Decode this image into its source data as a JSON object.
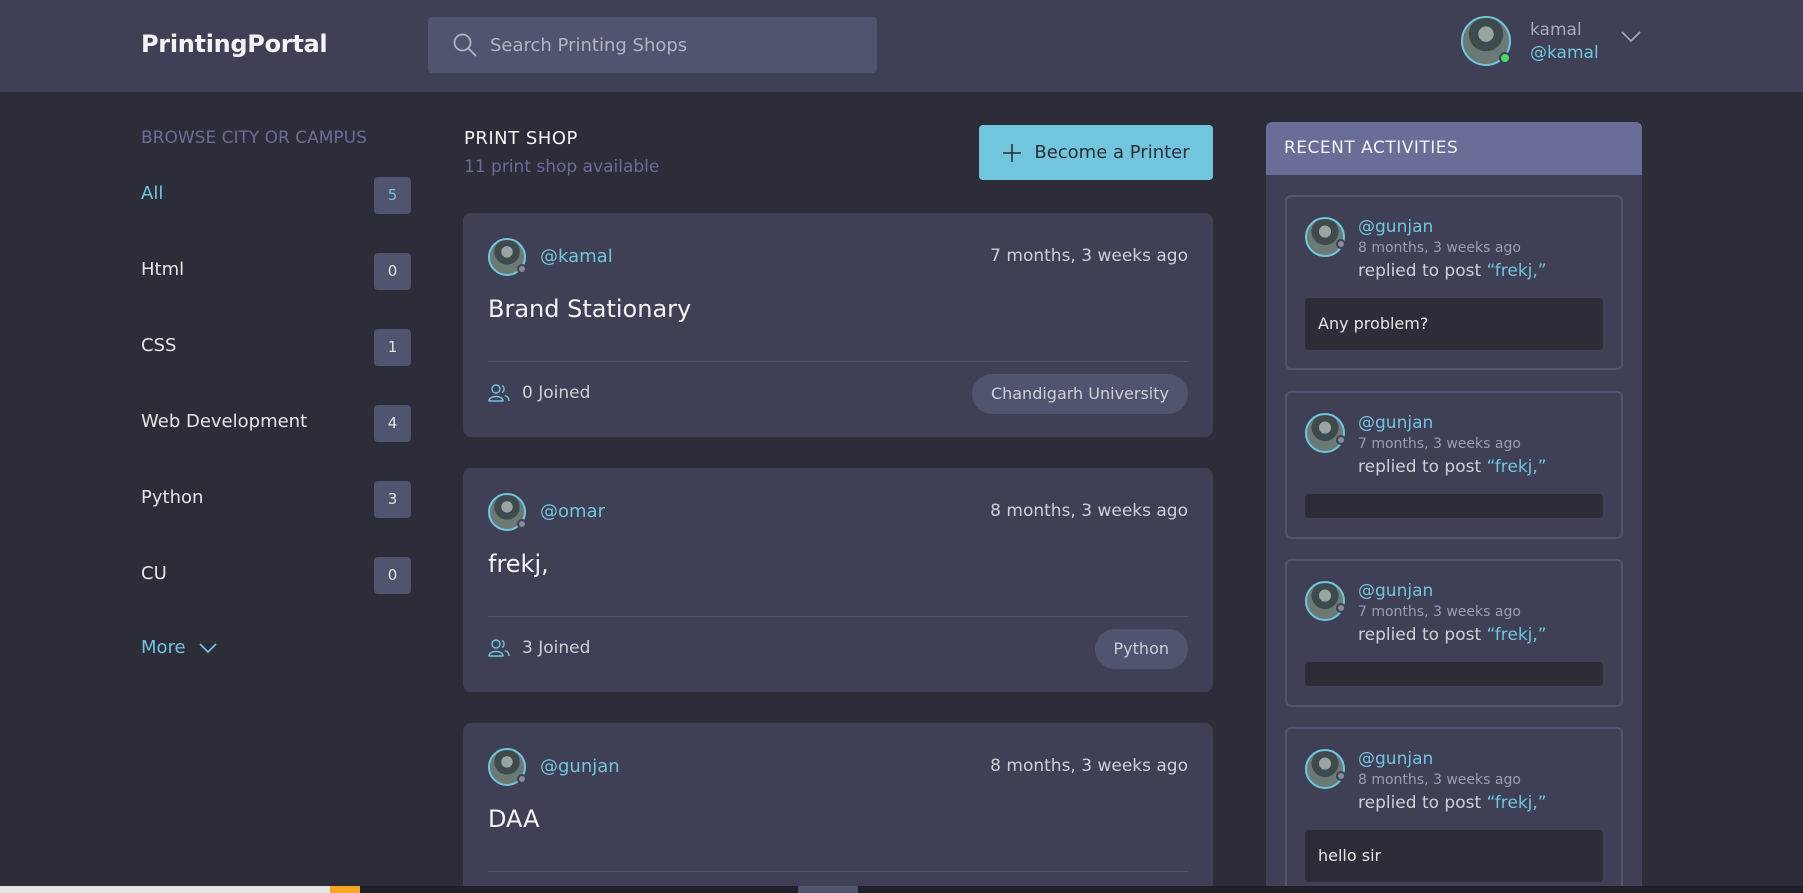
{
  "header": {
    "logo": "PrintingPortal",
    "search_placeholder": "Search Printing Shops",
    "user_name": "kamal",
    "user_handle": "@kamal"
  },
  "sidebar": {
    "title": "BROWSE CITY OR CAMPUS",
    "topics": [
      {
        "name": "All",
        "count": "5"
      },
      {
        "name": "Html",
        "count": "0"
      },
      {
        "name": "CSS",
        "count": "1"
      },
      {
        "name": "Web Development",
        "count": "4"
      },
      {
        "name": "Python",
        "count": "3"
      },
      {
        "name": "CU",
        "count": "0"
      }
    ],
    "more_label": "More"
  },
  "main": {
    "title": "PRINT SHOP",
    "subtitle": "11 print shop available",
    "become_label": "Become a Printer",
    "cards": [
      {
        "handle": "@kamal",
        "time": "7 months, 3 weeks ago",
        "title": "Brand Stationary",
        "joined": "0 Joined",
        "tag": "Chandigarh University"
      },
      {
        "handle": "@omar",
        "time": "8 months, 3 weeks ago",
        "title": "frekj,",
        "joined": "3 Joined",
        "tag": "Python"
      },
      {
        "handle": "@gunjan",
        "time": "8 months, 3 weeks ago",
        "title": "DAA",
        "joined": "",
        "tag": ""
      }
    ]
  },
  "activities": {
    "title": "RECENT ACTIVITIES",
    "replied_prefix": "replied to post ",
    "items": [
      {
        "handle": "@gunjan",
        "time": "8 months, 3 weeks ago",
        "post": "“frekj,”",
        "message": "Any problem?"
      },
      {
        "handle": "@gunjan",
        "time": "7 months, 3 weeks ago",
        "post": "“frekj,”",
        "message": ""
      },
      {
        "handle": "@gunjan",
        "time": "7 months, 3 weeks ago",
        "post": "“frekj,”",
        "message": ""
      },
      {
        "handle": "@gunjan",
        "time": "8 months, 3 weeks ago",
        "post": "“frekj,”",
        "message": "hello sir"
      }
    ]
  },
  "colors": {
    "accent": "#71c6dd",
    "background": "#2d2d39",
    "surface": "#3f4055",
    "muted": "#696d97"
  }
}
